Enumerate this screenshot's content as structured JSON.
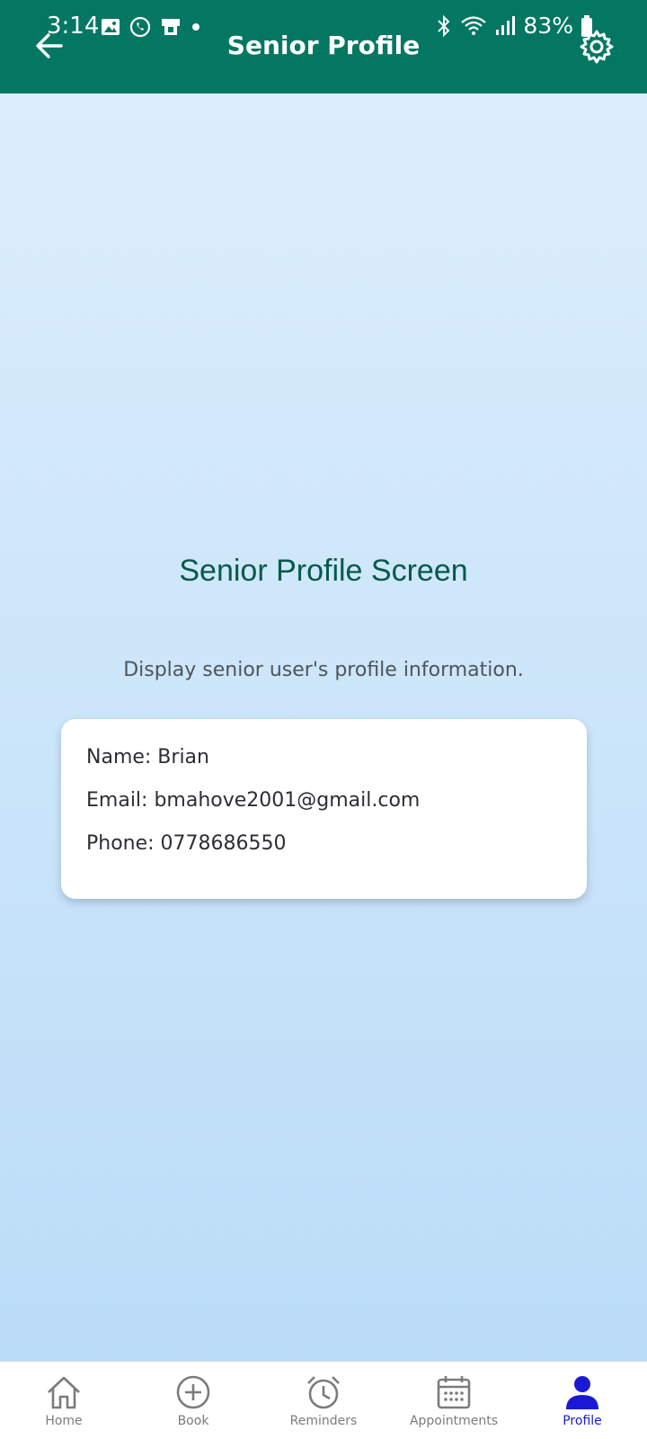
{
  "status_bar": {
    "time": "3:14",
    "battery": "83%"
  },
  "app_bar": {
    "title": "Senior Profile"
  },
  "main": {
    "heading": "Senior Profile Screen",
    "subtitle": "Display senior user's profile information.",
    "profile": {
      "name": "Name: Brian",
      "email": "Email: bmahove2001@gmail.com",
      "phone": "Phone: 0778686550"
    }
  },
  "bottom_nav": {
    "active": "Profile",
    "active_color": "#1a1ad6",
    "inactive_color": "#7b7b7b",
    "items": [
      {
        "label": "Home",
        "icon": "home-icon"
      },
      {
        "label": "Book",
        "icon": "plus-circle-icon"
      },
      {
        "label": "Reminders",
        "icon": "alarm-clock-icon"
      },
      {
        "label": "Appointments",
        "icon": "calendar-icon"
      },
      {
        "label": "Profile",
        "icon": "person-icon"
      }
    ]
  },
  "colors": {
    "app_bar": "#047763",
    "heading": "#065a4a",
    "background_top": "#deeffc",
    "background_bottom": "#b9dbf8"
  }
}
